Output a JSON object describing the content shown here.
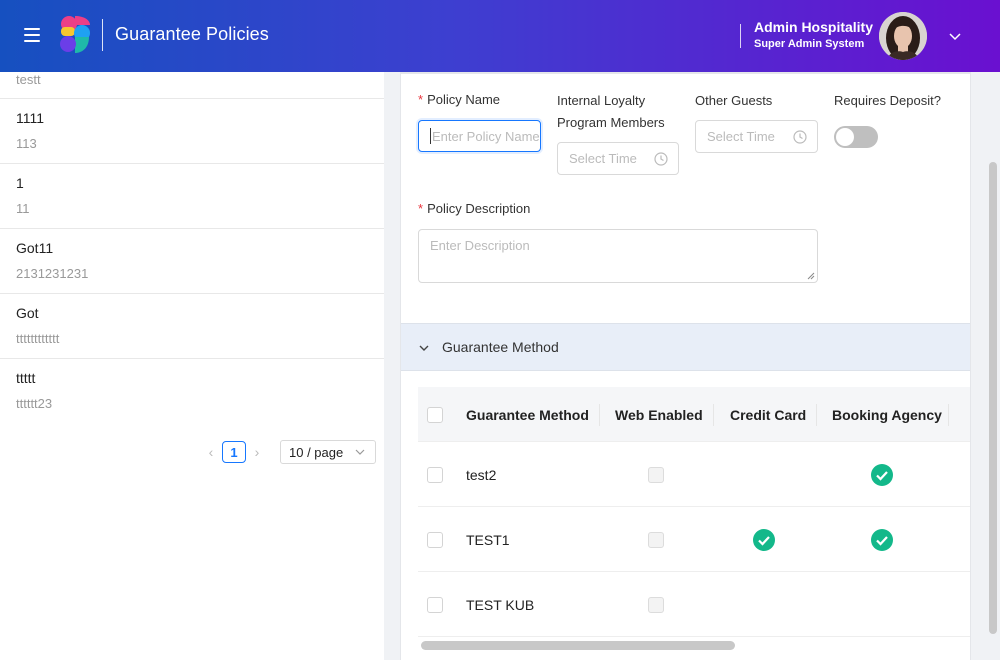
{
  "header": {
    "title": "Guarantee Policies",
    "user_name": "Admin Hospitality",
    "user_role": "Super Admin System"
  },
  "policy_list": {
    "items": [
      {
        "name": "",
        "code": "testt"
      },
      {
        "name": "1111",
        "code": "113"
      },
      {
        "name": "1",
        "code": "11"
      },
      {
        "name": "Got11",
        "code": "2131231231"
      },
      {
        "name": "Got",
        "code": "tttttttttttt"
      },
      {
        "name": "ttttt",
        "code": "tttttt23"
      }
    ],
    "pagination": {
      "current_page": "1",
      "page_size": "10 / page"
    }
  },
  "form": {
    "policy_name_label": "Policy Name",
    "policy_name_placeholder": "Enter Policy Name",
    "loyalty_label_line1": "Internal Loyalty",
    "loyalty_label_line2": "Program Members",
    "loyalty_placeholder": "Select Time",
    "other_guests_label": "Other Guests",
    "other_guests_placeholder": "Select Time",
    "requires_deposit_label": "Requires Deposit?",
    "requires_deposit_on": false,
    "description_label": "Policy Description",
    "description_placeholder": "Enter Description"
  },
  "guarantee_section": {
    "title": "Guarantee Method",
    "expanded": true,
    "columns": [
      "Guarantee Method",
      "Web Enabled",
      "Credit Card",
      "Booking Agency"
    ],
    "rows": [
      {
        "method": "test2",
        "credit_card": false,
        "booking_agency": true
      },
      {
        "method": "TEST1",
        "credit_card": true,
        "booking_agency": true
      },
      {
        "method": "TEST KUB",
        "credit_card": false,
        "booking_agency": false
      }
    ]
  },
  "colors": {
    "header_start": "#1650c0",
    "header_end": "#6a10d0",
    "accent": "#1677ff",
    "check_green": "#13b88a",
    "required": "#e8343c"
  }
}
